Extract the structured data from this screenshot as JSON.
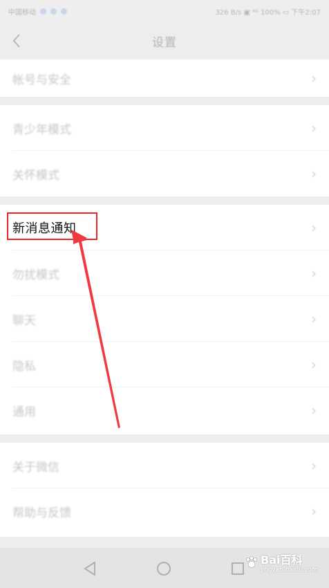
{
  "status_bar": {
    "carrier": "中国移动",
    "right_text": "326 B/s  ▣  ⁴ᴳ 100%  ▭  下午2:07"
  },
  "nav": {
    "title": "设置",
    "back_icon": "back-chevron-icon"
  },
  "groups": [
    {
      "items": [
        {
          "label": "帐号与安全"
        }
      ]
    },
    {
      "items": [
        {
          "label": "青少年模式"
        },
        {
          "label": "关怀模式"
        }
      ]
    },
    {
      "items": [
        {
          "label": "新消息通知"
        },
        {
          "label": "勿扰模式"
        },
        {
          "label": "聊天"
        },
        {
          "label": "隐私"
        },
        {
          "label": "通用"
        }
      ]
    },
    {
      "items": [
        {
          "label": "关于微信"
        },
        {
          "label": "帮助与反馈"
        }
      ]
    }
  ],
  "highlight": {
    "label": "新消息通知",
    "color": "#e8262a"
  },
  "bottom_nav": {
    "icons": [
      "back-triangle-icon",
      "home-circle-icon",
      "recents-square-icon"
    ]
  },
  "watermark": {
    "brand": "Bai",
    "brand_tail": "百科",
    "sub": "jingyan.baidu.com"
  }
}
